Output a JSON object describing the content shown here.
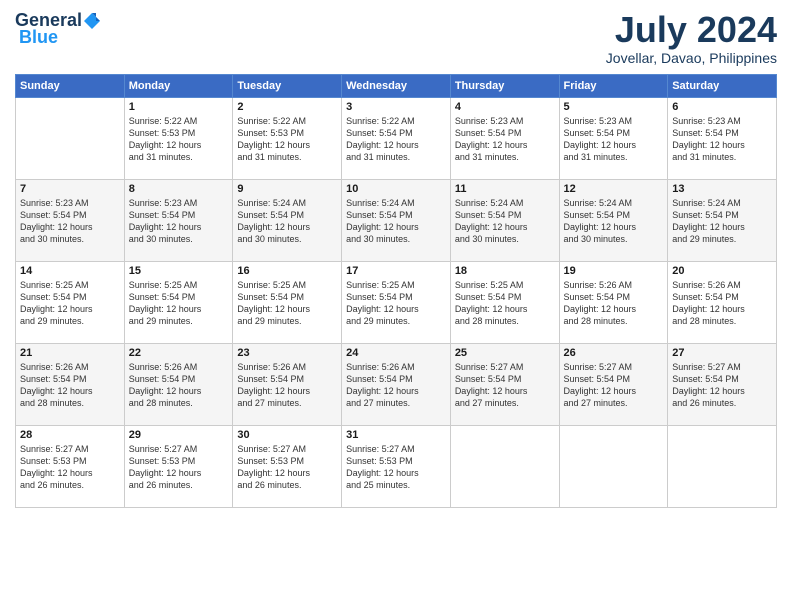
{
  "header": {
    "logo_general": "General",
    "logo_blue": "Blue",
    "month_title": "July 2024",
    "location": "Jovellar, Davao, Philippines"
  },
  "days_of_week": [
    "Sunday",
    "Monday",
    "Tuesday",
    "Wednesday",
    "Thursday",
    "Friday",
    "Saturday"
  ],
  "weeks": [
    [
      {
        "day": "",
        "info": ""
      },
      {
        "day": "1",
        "info": "Sunrise: 5:22 AM\nSunset: 5:53 PM\nDaylight: 12 hours\nand 31 minutes."
      },
      {
        "day": "2",
        "info": "Sunrise: 5:22 AM\nSunset: 5:53 PM\nDaylight: 12 hours\nand 31 minutes."
      },
      {
        "day": "3",
        "info": "Sunrise: 5:22 AM\nSunset: 5:54 PM\nDaylight: 12 hours\nand 31 minutes."
      },
      {
        "day": "4",
        "info": "Sunrise: 5:23 AM\nSunset: 5:54 PM\nDaylight: 12 hours\nand 31 minutes."
      },
      {
        "day": "5",
        "info": "Sunrise: 5:23 AM\nSunset: 5:54 PM\nDaylight: 12 hours\nand 31 minutes."
      },
      {
        "day": "6",
        "info": "Sunrise: 5:23 AM\nSunset: 5:54 PM\nDaylight: 12 hours\nand 31 minutes."
      }
    ],
    [
      {
        "day": "7",
        "info": "Sunrise: 5:23 AM\nSunset: 5:54 PM\nDaylight: 12 hours\nand 30 minutes."
      },
      {
        "day": "8",
        "info": "Sunrise: 5:23 AM\nSunset: 5:54 PM\nDaylight: 12 hours\nand 30 minutes."
      },
      {
        "day": "9",
        "info": "Sunrise: 5:24 AM\nSunset: 5:54 PM\nDaylight: 12 hours\nand 30 minutes."
      },
      {
        "day": "10",
        "info": "Sunrise: 5:24 AM\nSunset: 5:54 PM\nDaylight: 12 hours\nand 30 minutes."
      },
      {
        "day": "11",
        "info": "Sunrise: 5:24 AM\nSunset: 5:54 PM\nDaylight: 12 hours\nand 30 minutes."
      },
      {
        "day": "12",
        "info": "Sunrise: 5:24 AM\nSunset: 5:54 PM\nDaylight: 12 hours\nand 30 minutes."
      },
      {
        "day": "13",
        "info": "Sunrise: 5:24 AM\nSunset: 5:54 PM\nDaylight: 12 hours\nand 29 minutes."
      }
    ],
    [
      {
        "day": "14",
        "info": "Sunrise: 5:25 AM\nSunset: 5:54 PM\nDaylight: 12 hours\nand 29 minutes."
      },
      {
        "day": "15",
        "info": "Sunrise: 5:25 AM\nSunset: 5:54 PM\nDaylight: 12 hours\nand 29 minutes."
      },
      {
        "day": "16",
        "info": "Sunrise: 5:25 AM\nSunset: 5:54 PM\nDaylight: 12 hours\nand 29 minutes."
      },
      {
        "day": "17",
        "info": "Sunrise: 5:25 AM\nSunset: 5:54 PM\nDaylight: 12 hours\nand 29 minutes."
      },
      {
        "day": "18",
        "info": "Sunrise: 5:25 AM\nSunset: 5:54 PM\nDaylight: 12 hours\nand 28 minutes."
      },
      {
        "day": "19",
        "info": "Sunrise: 5:26 AM\nSunset: 5:54 PM\nDaylight: 12 hours\nand 28 minutes."
      },
      {
        "day": "20",
        "info": "Sunrise: 5:26 AM\nSunset: 5:54 PM\nDaylight: 12 hours\nand 28 minutes."
      }
    ],
    [
      {
        "day": "21",
        "info": "Sunrise: 5:26 AM\nSunset: 5:54 PM\nDaylight: 12 hours\nand 28 minutes."
      },
      {
        "day": "22",
        "info": "Sunrise: 5:26 AM\nSunset: 5:54 PM\nDaylight: 12 hours\nand 28 minutes."
      },
      {
        "day": "23",
        "info": "Sunrise: 5:26 AM\nSunset: 5:54 PM\nDaylight: 12 hours\nand 27 minutes."
      },
      {
        "day": "24",
        "info": "Sunrise: 5:26 AM\nSunset: 5:54 PM\nDaylight: 12 hours\nand 27 minutes."
      },
      {
        "day": "25",
        "info": "Sunrise: 5:27 AM\nSunset: 5:54 PM\nDaylight: 12 hours\nand 27 minutes."
      },
      {
        "day": "26",
        "info": "Sunrise: 5:27 AM\nSunset: 5:54 PM\nDaylight: 12 hours\nand 27 minutes."
      },
      {
        "day": "27",
        "info": "Sunrise: 5:27 AM\nSunset: 5:54 PM\nDaylight: 12 hours\nand 26 minutes."
      }
    ],
    [
      {
        "day": "28",
        "info": "Sunrise: 5:27 AM\nSunset: 5:53 PM\nDaylight: 12 hours\nand 26 minutes."
      },
      {
        "day": "29",
        "info": "Sunrise: 5:27 AM\nSunset: 5:53 PM\nDaylight: 12 hours\nand 26 minutes."
      },
      {
        "day": "30",
        "info": "Sunrise: 5:27 AM\nSunset: 5:53 PM\nDaylight: 12 hours\nand 26 minutes."
      },
      {
        "day": "31",
        "info": "Sunrise: 5:27 AM\nSunset: 5:53 PM\nDaylight: 12 hours\nand 25 minutes."
      },
      {
        "day": "",
        "info": ""
      },
      {
        "day": "",
        "info": ""
      },
      {
        "day": "",
        "info": ""
      }
    ]
  ]
}
